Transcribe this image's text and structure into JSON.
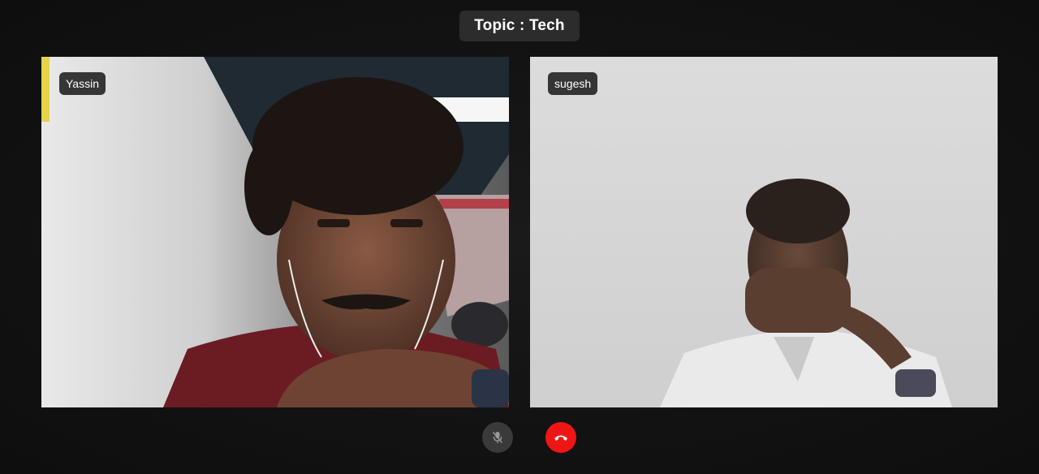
{
  "header": {
    "topic_label": "Topic : Tech"
  },
  "participants": [
    {
      "name": "Yassin"
    },
    {
      "name": "sugesh"
    }
  ],
  "controls": {
    "mic_icon": "mic-muted-icon",
    "hangup_icon": "phone-hangup-icon",
    "hangup_color": "#f01515",
    "mic_bg_color": "#3a3a3a"
  },
  "theme": {
    "background": "#121212",
    "pill_background": "#2c2c2c"
  }
}
